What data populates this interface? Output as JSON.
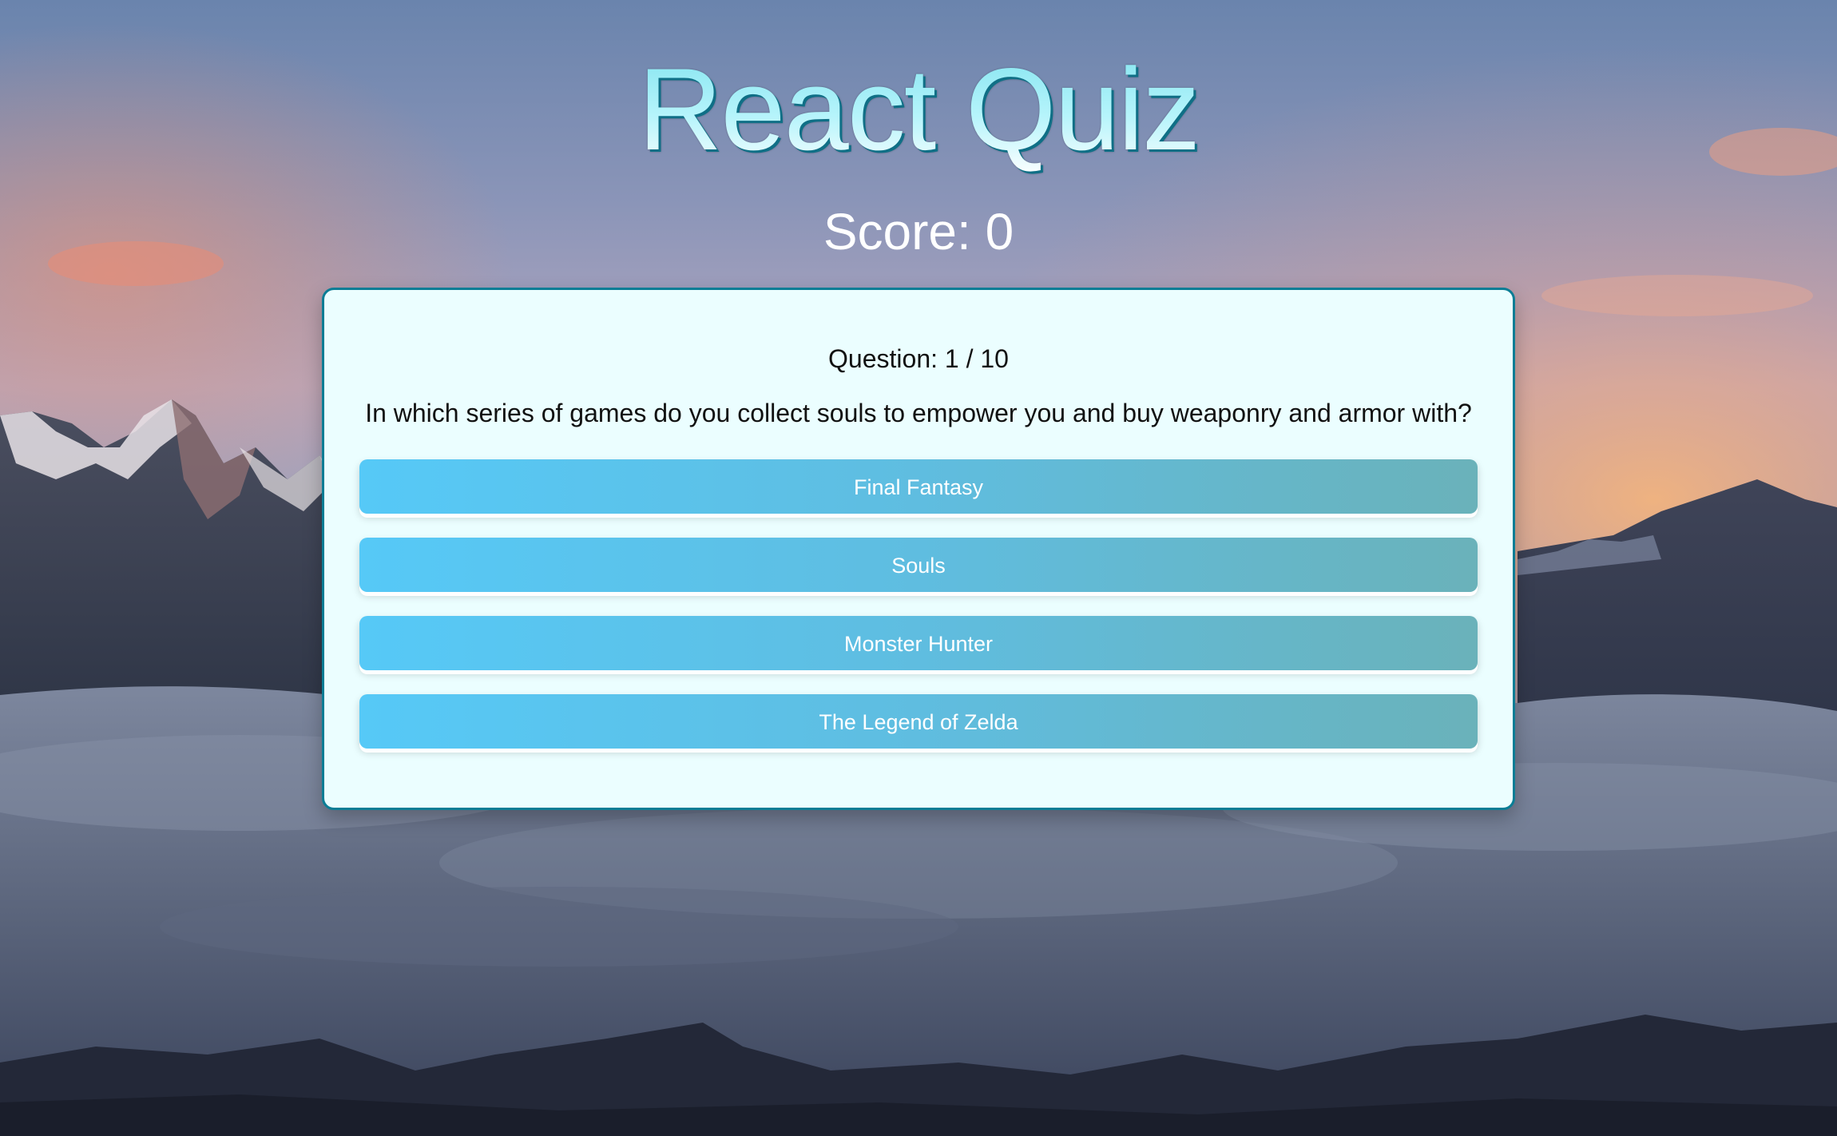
{
  "app": {
    "title": "React Quiz",
    "score_text": "Score: 0"
  },
  "question": {
    "number_text": "Question: 1 / 10",
    "text": "In which series of games do you collect souls to empower you and buy weaponry and armor with?"
  },
  "answers": [
    {
      "label": "Final Fantasy"
    },
    {
      "label": "Souls"
    },
    {
      "label": "Monster Hunter"
    },
    {
      "label": "The Legend of Zelda"
    }
  ],
  "colors": {
    "title_gradient_top": "#7fe3ef",
    "title_shadow": "#0f6f86",
    "card_background": "#ebfeff",
    "card_border": "#0a7d95",
    "answer_gradient_start": "#56c9f7",
    "answer_gradient_end": "#6ab2ba"
  }
}
